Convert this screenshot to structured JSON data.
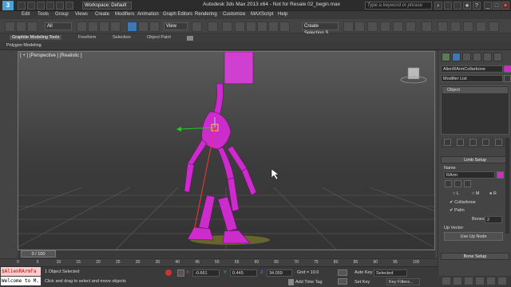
{
  "title_bar": {
    "workspace": "Workspace: Default",
    "app_title": "Autodesk 3ds Max  2013 x64  -  Not for Resale    02_begin.max",
    "search_placeholder": "Type a keyword or phrase"
  },
  "menu": [
    "Edit",
    "Tools",
    "Group",
    "Views",
    "Create",
    "Modifiers",
    "Animation",
    "Graph Editors",
    "Rendering",
    "Customize",
    "MAXScript",
    "Help"
  ],
  "toolbar": {
    "filter": "All",
    "view_dropdown": "View",
    "selection_set": "Create Selection S"
  },
  "ribbon": {
    "tabs": [
      "Graphite Modeling Tools",
      "Freeform",
      "Selection",
      "Object Paint"
    ],
    "sub_tab": "Polygon Modeling"
  },
  "viewport": {
    "label": "[ + ] [Perspective ] [Realistic ]"
  },
  "command_panel": {
    "object_name": "AlienRArmCollarbone",
    "modifier_list": "Modifier List",
    "stack_item": "Object",
    "limb_rollout": "Limb Setup",
    "name_label": "Name",
    "name_value": "RArm",
    "radio_options": [
      "L",
      "M",
      "R"
    ],
    "collarbone_label": "Collarbone",
    "palm_label": "Palm",
    "bones_label": "Bones:",
    "bones_value": "2",
    "up_vector_label": "Up Vector",
    "up_node_button": "Use Up Node",
    "bone_rollout": "Bone Setup"
  },
  "timeline": {
    "slider": "0 / 100",
    "ticks": [
      "0",
      "5",
      "10",
      "15",
      "20",
      "25",
      "30",
      "35",
      "40",
      "45",
      "50",
      "55",
      "60",
      "65",
      "70",
      "75",
      "80",
      "85",
      "90",
      "95",
      "100"
    ]
  },
  "status": {
    "maxscript_line1": "$AlienRArmFa",
    "maxscript_line2": "Welcome to M.",
    "selection_info": "1 Object Selected",
    "prompt": "Click and drag to select and move objects",
    "x_value": "-0.661",
    "y_value": "0.445",
    "z_value": "34.059",
    "grid": "Grid = 10.0",
    "add_time_tag": "Add Time Tag",
    "auto_key": "Auto Key",
    "set_key": "Set Key",
    "key_mode": "Selected",
    "key_filters": "Key Filters..."
  }
}
